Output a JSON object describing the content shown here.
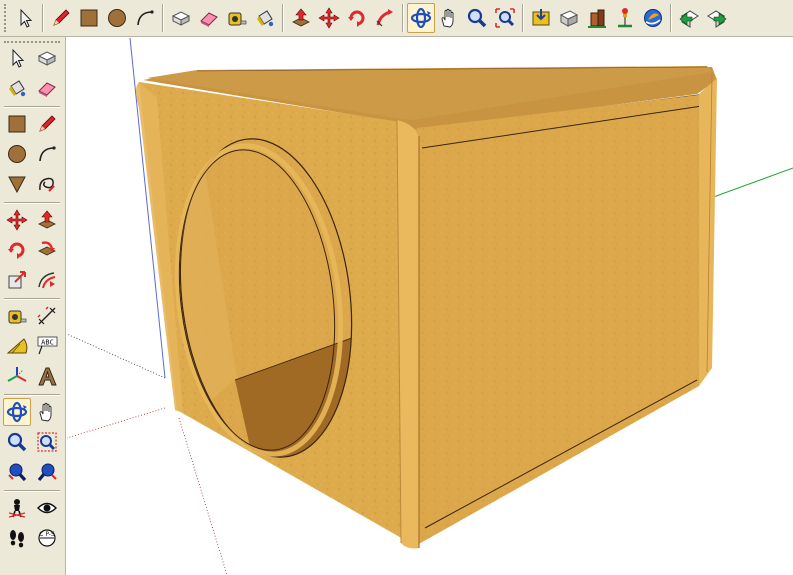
{
  "top_toolbar": {
    "groups": [
      [
        "select-icon"
      ],
      [
        "pencil-icon",
        "rectangle-icon",
        "circle-icon",
        "arc-icon"
      ],
      [
        "make-component-icon",
        "eraser-icon",
        "tape-measure-icon",
        "paint-bucket-icon"
      ],
      [
        "push-pull-icon",
        "move-icon",
        "rotate-icon",
        "follow-me-icon"
      ],
      [
        "orbit-icon",
        "pan-icon",
        "zoom-icon",
        "zoom-extents-icon"
      ],
      [
        "get-models-icon",
        "share-model-icon",
        "add-building-icon",
        "place-model-icon",
        "google-earth-icon"
      ],
      [
        "previous-view-icon",
        "next-view-icon"
      ]
    ],
    "active_tool": "orbit-icon"
  },
  "left_toolbar": {
    "tools": [
      [
        "select-icon",
        "make-component-icon"
      ],
      [
        "paint-bucket-icon",
        "eraser-icon"
      ],
      [
        "rectangle-icon",
        "line-icon"
      ],
      [
        "circle-icon",
        "arc-icon"
      ],
      [
        "polygon-icon",
        "freehand-icon"
      ],
      [
        "move-icon",
        "push-pull-icon"
      ],
      [
        "rotate-icon",
        "follow-me-icon"
      ],
      [
        "scale-icon",
        "offset-icon"
      ],
      [
        "tape-measure-icon",
        "dimension-icon"
      ],
      [
        "protractor-icon",
        "text-icon"
      ],
      [
        "axes-icon",
        "3d-text-icon"
      ],
      [
        "orbit-icon",
        "pan-icon"
      ],
      [
        "zoom-icon",
        "zoom-window-icon"
      ],
      [
        "zoom-extents-icon",
        "previous-icon"
      ],
      [
        "position-camera-icon",
        "look-around-icon"
      ],
      [
        "walk-icon",
        "section-plane-icon"
      ]
    ],
    "text_tool_label": "ABC",
    "section_tool_label": "C P-S",
    "active_tool": "orbit-icon"
  },
  "model": {
    "name": "speaker-enclosure",
    "colors": {
      "wood_front": "#deaa4a",
      "wood_side": "#dca648",
      "wood_top": "#c8923c",
      "wood_edge": "#e8b85a",
      "hole_inside": "#d9a346",
      "hole_bottom": "#a06a24",
      "axis_red": "#e03030",
      "axis_green": "#22aa33",
      "axis_blue": "#3344cc"
    }
  }
}
